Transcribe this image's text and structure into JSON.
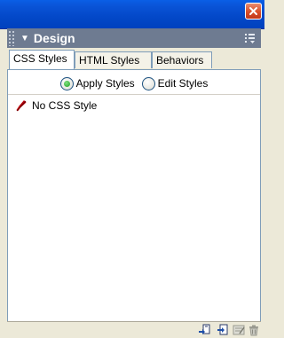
{
  "panel": {
    "title": "Design"
  },
  "tabs": [
    {
      "label": "CSS Styles",
      "active": true
    },
    {
      "label": "HTML Styles",
      "active": false
    },
    {
      "label": "Behaviors",
      "active": false
    }
  ],
  "radio_options": [
    {
      "label": "Apply Styles",
      "checked": true
    },
    {
      "label": "Edit Styles",
      "checked": false
    }
  ],
  "styles_list": [
    {
      "label": "No CSS Style",
      "icon": "no-style-brush-icon"
    }
  ],
  "footer_icons": [
    "attach-style-sheet-icon",
    "new-css-style-icon",
    "edit-style-sheet-icon",
    "trash-icon"
  ],
  "colors": {
    "titlebar": "#0348c8",
    "panel_header": "#6e7b91",
    "close_button": "#d94e28",
    "radio_checked": "#21a121"
  }
}
